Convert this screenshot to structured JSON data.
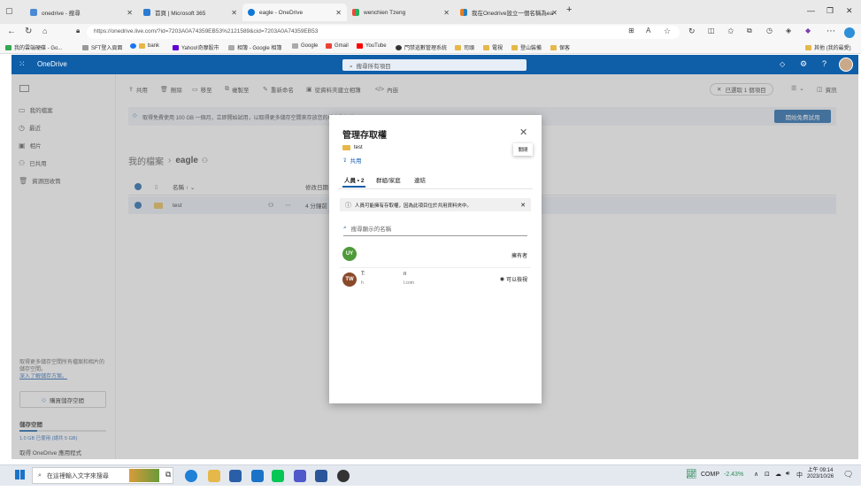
{
  "browser": {
    "tabs": [
      {
        "title": "onedrive - 搜尋",
        "color": "#4a8ad4"
      },
      {
        "title": "首頁 | Microsoft 365",
        "color": "#2b7cd3"
      },
      {
        "title": "eagle - OneDrive",
        "color": "#0f78d4"
      },
      {
        "title": "wenchien Tzeng",
        "color": "#e74c3c"
      },
      {
        "title": "我在Onedrive設立一個名稱為ea",
        "color": "#e67e22"
      }
    ],
    "new_tab": "+",
    "url": "https://onedrive.live.com/?id=7203A0A74359EB53%2121589&cid=7203A0A74359EB53",
    "zoom_label": "A",
    "bookmarks": [
      "我的雲端硬碟 - Go...",
      "SFT登入頁面",
      "bank",
      "Yahoo!奇摩股市",
      "相簿 - Google 相簿",
      "Google",
      "Gmail",
      "YouTube",
      "門禁巡數管理系統",
      "司頭",
      "電視",
      "登山裝備",
      "保客"
    ],
    "other_bookmarks": "其他 (我的最愛)"
  },
  "onedrive": {
    "brand": "OneDrive",
    "search_placeholder": "搜尋所有項目",
    "sidebar": {
      "items": [
        "我的檔案",
        "最近",
        "相片",
        "已共用",
        "資源回收筒"
      ],
      "promo_text": "取得更多儲存空間所有檔案和相片的儲存空間。",
      "promo_link": "深入了解儲存方案。",
      "buy_button": "購買儲存空間",
      "storage_title": "儲存空間",
      "storage_usage": "1.0 GB 已使用 (總共 5 GB)",
      "storage_fraction": 0.2,
      "get_apps": "取得 OneDrive 應用程式"
    },
    "commands": [
      "共用",
      "刪除",
      "移至",
      "複製至",
      "重新命名",
      "從資料夾建立相簿",
      "內嵌"
    ],
    "selection": "已選取 1 個項目",
    "view_menu": "",
    "info": "資訊",
    "promo_banner": "取得免費使用 100 GB 一個月，立即開始試用，以取得更多儲存空間來存放您的檔案和相片。",
    "promo_cta": "開始免費試用",
    "breadcrumb": {
      "root": "我的檔案",
      "current": "eagle"
    },
    "table": {
      "col_name": "名稱",
      "col_modified": "修改日期",
      "rows": [
        {
          "name": "test",
          "modified": "4 分鐘前"
        }
      ]
    }
  },
  "dialog": {
    "title": "管理存取權",
    "close_tooltip": "關閉",
    "item_name": "test",
    "share_link": "共用",
    "tabs": [
      "人員 • 2",
      "群組/家庭",
      "連結"
    ],
    "info_banner": "人員可能擁有存取權，因為此項目位於共用資料夾中。",
    "search_placeholder": "搜尋顯示的名稱",
    "people": [
      {
        "initials": "UY",
        "color": "#4e9a3a",
        "name": "",
        "email": "",
        "role": "擁有者"
      },
      {
        "initials": "TW",
        "color": "#8a4a2a",
        "name": "T:",
        "name_tail": "n",
        "email": "h",
        "email_tail": "l.com",
        "role": "可以檢視"
      }
    ]
  },
  "taskbar": {
    "search_placeholder": "在這裡輸入文字來搜尋",
    "stock_name": "COMP",
    "stock_change": "-2.43%",
    "ime": "中",
    "time": "上午 09:14",
    "date": "2023/10/26"
  }
}
